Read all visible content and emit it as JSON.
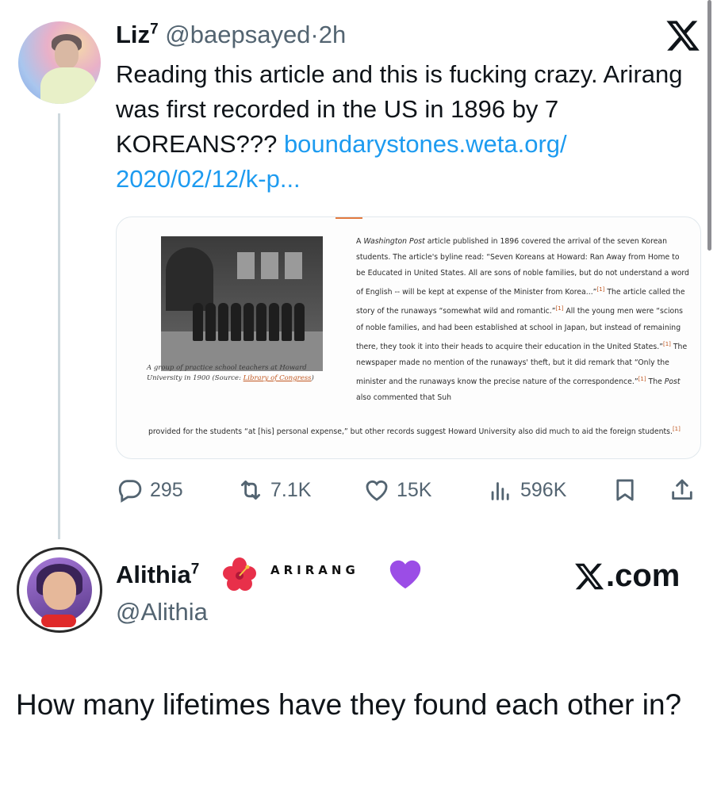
{
  "tweet": {
    "author_name": "Liz",
    "author_sup": "7",
    "handle": "@baepsayed",
    "separator": "·",
    "time": "2h",
    "text": "Reading this article and this is fucking crazy. Arirang was first recorded in the US in 1896 by 7 KOREANS??? ",
    "link": "boundarystones.weta.org/ 2020/02/12/k-p...",
    "card": {
      "caption": "A group of practice school teachers at Howard University in 1900 (Source: ",
      "caption_source": "Library of Congress",
      "caption_end": ")",
      "article_lead": "A ",
      "article_pub": "Washington Post",
      "article_p1": " article published in 1896 covered the arrival of the seven Korean students. The article's byline read: “Seven Koreans at Howard: Ran Away from Home to be Educated in United States. All are sons of noble families, but do not understand a word of English -- will be kept at expense of the Minister from Korea...”",
      "ref": "[1]",
      "article_p2": " The article called the story of the runaways “somewhat wild and romantic.”",
      "article_p3": " All the young men were “scions of noble families, and had been established at school in Japan, but instead of remaining there, they took it into their heads to acquire their education in the United States.”",
      "article_p4": " The newspaper made no mention of the runaways' theft, but it did remark that “Only the minister and the runaways know the precise nature of the correspondence.”",
      "article_p5": " The ",
      "article_post": "Post",
      "article_p6": " also commented that Suh",
      "article_tail": "provided for the students “at [his] personal expense,” but other records suggest Howard University also did much to aid the foreign students."
    },
    "actions": {
      "replies": "295",
      "reposts": "7.1K",
      "likes": "15K",
      "views": "596K"
    }
  },
  "reply": {
    "author_name": "Alithia",
    "author_sup": "7",
    "decoration_text": "ARIRANG",
    "handle": "@Alithia",
    "source_text": ".com",
    "text": "How many lifetimes have they found each other in?"
  },
  "icons": [
    "x-logo-icon",
    "reply-icon",
    "repost-icon",
    "like-icon",
    "views-icon",
    "bookmark-icon",
    "share-icon",
    "hibiscus-icon",
    "purple-heart-icon"
  ],
  "colors": {
    "link": "#1d9bf0",
    "muted": "#536471",
    "text": "#0f1419",
    "source_link": "#c0561f"
  }
}
